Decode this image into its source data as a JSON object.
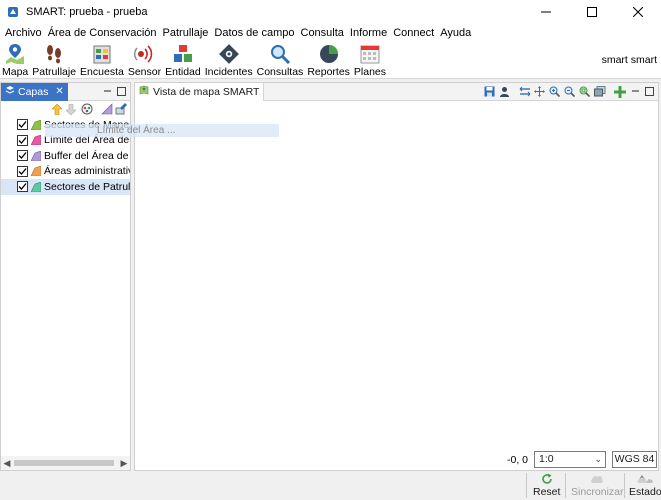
{
  "window": {
    "title": "SMART: prueba - prueba"
  },
  "menu": [
    "Archivo",
    "Área de Conservación",
    "Patrullaje",
    "Datos de campo",
    "Consulta",
    "Informe",
    "Connect",
    "Ayuda"
  ],
  "toolbar": {
    "items": [
      {
        "label": "Mapa",
        "icon": "map-pin-icon"
      },
      {
        "label": "Patrullaje",
        "icon": "footprints-icon"
      },
      {
        "label": "Encuesta",
        "icon": "survey-icon"
      },
      {
        "label": "Sensor",
        "icon": "sensor-icon"
      },
      {
        "label": "Entidad",
        "icon": "entity-icon"
      },
      {
        "label": "Incidentes",
        "icon": "incident-icon"
      },
      {
        "label": "Consultas",
        "icon": "magnifier-icon"
      },
      {
        "label": "Reportes",
        "icon": "pie-chart-icon"
      },
      {
        "label": "Planes",
        "icon": "calendar-icon"
      }
    ],
    "user": "smart smart"
  },
  "layers_panel": {
    "tab": "Capas",
    "layers": [
      {
        "label": "Sectores de Manejo",
        "checked": true,
        "color": "#8bc34a"
      },
      {
        "label": "Límite del Área de C",
        "checked": true,
        "color": "#e85aa6"
      },
      {
        "label": "Buffer del Área de M",
        "checked": true,
        "color": "#b19ad9"
      },
      {
        "label": "Áreas administrativa",
        "checked": true,
        "color": "#f0a050"
      },
      {
        "label": "Sectores de Patrullaj",
        "checked": true,
        "color": "#5fc9a0"
      }
    ],
    "drag_text": "Límite del Área ..."
  },
  "map_panel": {
    "tab": "Vista de mapa SMART",
    "coordinates": "-0, 0",
    "scale": "1:0",
    "crs": "WGS 84"
  },
  "statusbar": {
    "reset": "Reset",
    "sync": "Sincronizar",
    "status": "Estado"
  }
}
